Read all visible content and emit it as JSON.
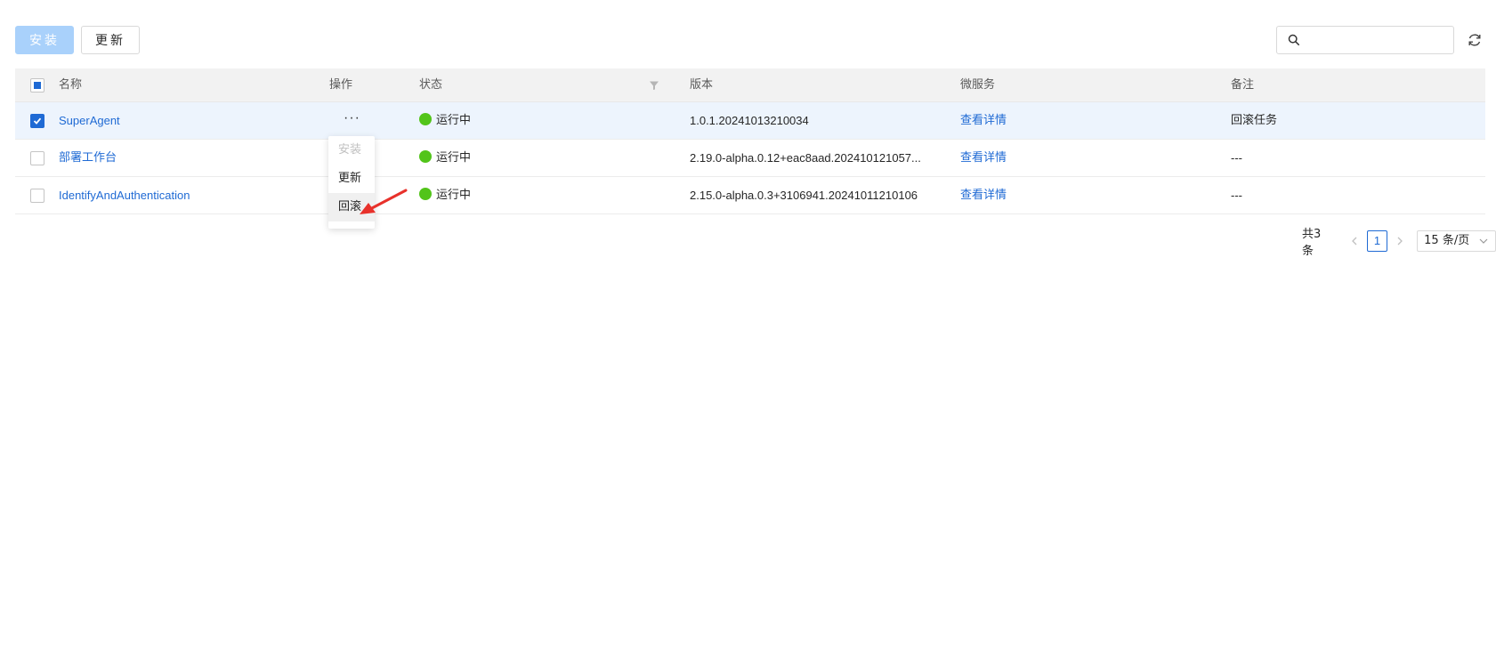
{
  "toolbar": {
    "install_label": "安装",
    "update_label": "更新"
  },
  "search": {
    "value": "",
    "placeholder": ""
  },
  "table": {
    "columns": {
      "name": "名称",
      "action": "操作",
      "status": "状态",
      "version": "版本",
      "microservice": "微服务",
      "remark": "备注"
    },
    "more_label": "···",
    "rows": [
      {
        "name": "SuperAgent",
        "status": "运行中",
        "version": "1.0.1.20241013210034",
        "microservice": "查看详情",
        "remark": "回滚任务",
        "checked": true
      },
      {
        "name": "部署工作台",
        "status": "运行中",
        "version": "2.19.0-alpha.0.12+eac8aad.202410121057...",
        "microservice": "查看详情",
        "remark": "---",
        "checked": false
      },
      {
        "name": "IdentifyAndAuthentication",
        "status": "运行中",
        "version": "2.15.0-alpha.0.3+3106941.20241011210106",
        "microservice": "查看详情",
        "remark": "---",
        "checked": false
      }
    ]
  },
  "dropdown": {
    "items": [
      "安装",
      "更新",
      "回滚"
    ],
    "disabled": [
      "安装"
    ],
    "hovered": "回滚"
  },
  "pagination": {
    "total": "共3条",
    "current_page": "1",
    "page_size": "15 条/页"
  },
  "colors": {
    "primary": "#1f6ad4",
    "status_running": "#52c41a",
    "annotation_arrow": "#e8312b"
  },
  "icons": {
    "search": "search-icon",
    "refresh": "refresh-icon",
    "filter": "filter-icon",
    "arrow": "annotation-arrow"
  }
}
